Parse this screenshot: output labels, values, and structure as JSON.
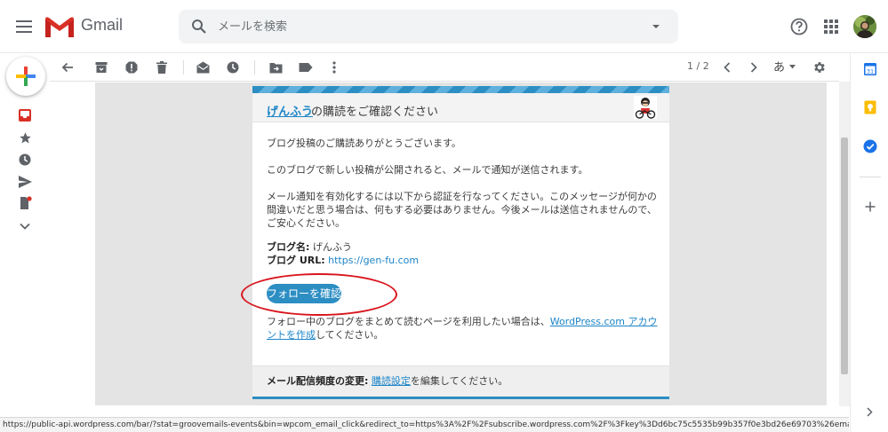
{
  "header": {
    "app_name": "Gmail",
    "search_placeholder": "メールを検索"
  },
  "toolbar": {
    "pager": "1 / 2",
    "input_tool_label": "あ"
  },
  "email": {
    "blog_name_link": "げんふう",
    "heading_suffix": "の購読をご確認ください",
    "para1": "ブログ投稿のご購読ありがとうございます。",
    "para2": "このブログで新しい投稿が公開されると、メールで通知が送信されます。",
    "para3": "メール通知を有効化するには以下から認証を行なってください。このメッセージが何かの間違いだと思う場合は、何もする必要はありません。今後メールは送信されませんので、ご安心ください。",
    "blog_name_label": "ブログ名:",
    "blog_name_value": "げんふう",
    "blog_url_label": "ブログ URL:",
    "blog_url_value": "https://gen-fu.com",
    "follow_button": "フォローを確認",
    "para4_prefix": "フォロー中のブログをまとめて読むページを利用したい場合は、",
    "para4_link": "WordPress.com アカウントを作成",
    "para4_suffix": "してください。",
    "footer_label": "メール配信頻度の変更:",
    "footer_link": "購読設定",
    "footer_suffix": "を編集してください。"
  },
  "status_url": "https://public-api.wordpress.com/bar/?stat=groovemails-events&bin=wpcom_email_click&redirect_to=https%3A%2F%2Fsubscribe.wordpress.com%2F%3Fkey%3Dd6bc75c5535b99b357f0e3bd26e69703%26email%3Dkjh.sako%2540gm...",
  "colors": {
    "accent": "#2d8ec3",
    "link": "#1c85c8",
    "highlight_circle": "#d8161e"
  }
}
